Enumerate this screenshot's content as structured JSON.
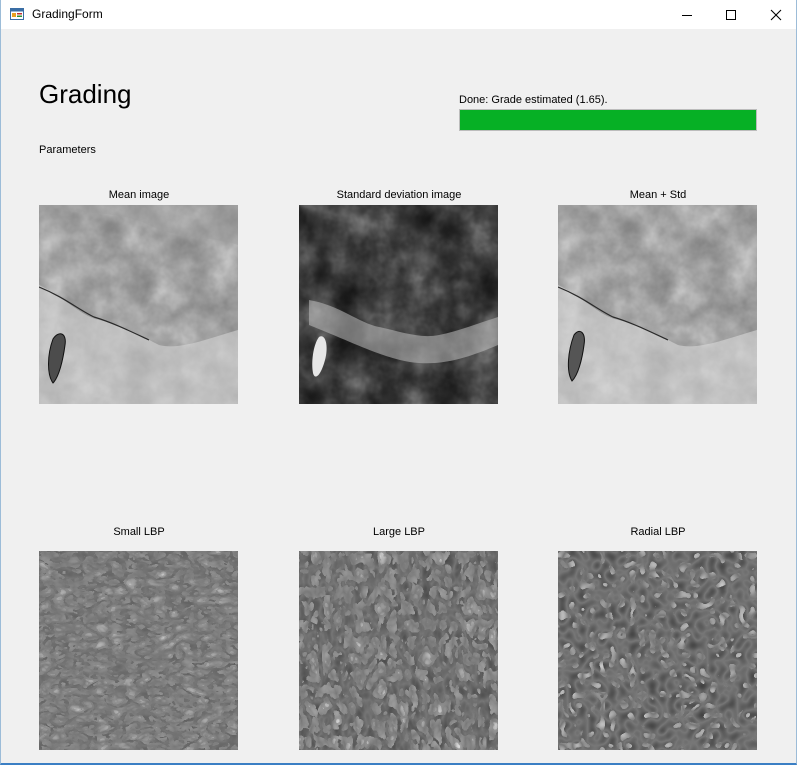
{
  "window": {
    "title": "GradingForm",
    "icons": {
      "app": "app-form-icon",
      "minimize": "minimize-icon",
      "maximize": "maximize-icon",
      "close": "close-icon"
    }
  },
  "main": {
    "heading": "Grading",
    "parameters_label": "Parameters",
    "status": {
      "text": "Done: Grade estimated (1.65).",
      "progress_percent": 100,
      "progress_color": "#06b025"
    }
  },
  "images": [
    {
      "caption": "Mean image"
    },
    {
      "caption": "Standard deviation image"
    },
    {
      "caption": "Mean + Std"
    },
    {
      "caption": "Small LBP"
    },
    {
      "caption": "Large LBP"
    },
    {
      "caption": "Radial LBP"
    }
  ]
}
